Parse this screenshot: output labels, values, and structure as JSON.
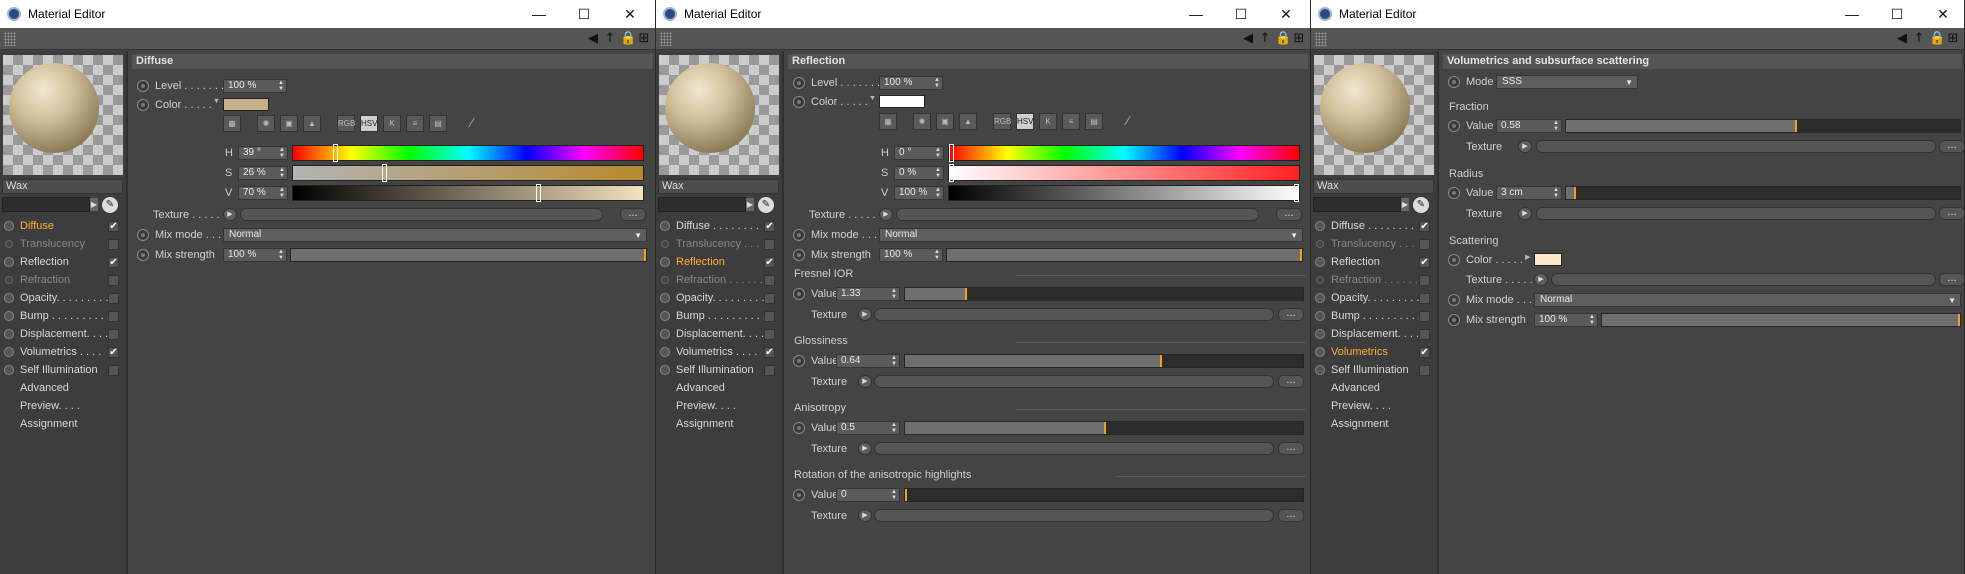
{
  "windows": [
    {
      "title": "Material Editor",
      "material_name": "Wax",
      "channels": [
        {
          "label": "Diffuse",
          "checked": true,
          "state": "selected"
        },
        {
          "label": "Translucency",
          "checked": false,
          "state": "disabled"
        },
        {
          "label": "Reflection",
          "checked": true,
          "state": "normal"
        },
        {
          "label": "Refraction",
          "checked": false,
          "state": "disabled"
        },
        {
          "label": "Opacity. . . . . . . . .",
          "checked": false,
          "state": "normal"
        },
        {
          "label": "Bump . . . . . . . . . .",
          "checked": false,
          "state": "normal"
        },
        {
          "label": "Displacement. . . .",
          "checked": false,
          "state": "normal"
        },
        {
          "label": "Volumetrics . . . .",
          "checked": true,
          "state": "normal"
        },
        {
          "label": "Self Illumination",
          "checked": false,
          "state": "normal"
        }
      ],
      "extra_items": [
        "Advanced",
        "Preview. . . .",
        "Assignment"
      ],
      "section": "Diffuse",
      "level_label": "Level . . . . . . .",
      "level_value": "100 %",
      "color_label": "Color . . . . .",
      "color_swatch": "#c4b18c",
      "h_label": "H",
      "h_value": "39 °",
      "h_pos": 0.12,
      "s_label": "S",
      "s_value": "26 %",
      "s_pos": 0.26,
      "v_label": "V",
      "v_value": "70 %",
      "v_pos": 0.7,
      "texture_label": "Texture . . . . . . .",
      "mixmode_label": "Mix mode . . .",
      "mixmode_value": "Normal",
      "mixstrength_label": "Mix strength",
      "mixstrength_value": "100 %",
      "dots": "..."
    },
    {
      "title": "Material Editor",
      "material_name": "Wax",
      "channels": [
        {
          "label": "Diffuse . . . . . . . .",
          "checked": true,
          "state": "normal"
        },
        {
          "label": "Translucency . . .",
          "checked": false,
          "state": "disabled"
        },
        {
          "label": "Reflection",
          "checked": true,
          "state": "selected"
        },
        {
          "label": "Refraction . . . . . .",
          "checked": false,
          "state": "disabled"
        },
        {
          "label": "Opacity. . . . . . . . .",
          "checked": false,
          "state": "normal"
        },
        {
          "label": "Bump . . . . . . . . . .",
          "checked": false,
          "state": "normal"
        },
        {
          "label": "Displacement. . . .",
          "checked": false,
          "state": "normal"
        },
        {
          "label": "Volumetrics . . . .",
          "checked": true,
          "state": "normal"
        },
        {
          "label": "Self Illumination",
          "checked": false,
          "state": "normal"
        }
      ],
      "extra_items": [
        "Advanced",
        "Preview. . . .",
        "Assignment"
      ],
      "section": "Reflection",
      "level_label": "Level . . . . . . .",
      "level_value": "100 %",
      "color_label": "Color . . . . .",
      "color_swatch": "#ffffff",
      "h_label": "H",
      "h_value": "0 °",
      "h_pos": 0.0,
      "s_label": "S",
      "s_value": "0 %",
      "s_pos": 0.0,
      "v_label": "V",
      "v_value": "100 %",
      "v_pos": 1.0,
      "texture_label": "Texture . . . . . . .",
      "mixmode_label": "Mix mode . . .",
      "mixmode_value": "Normal",
      "mixstrength_label": "Mix strength",
      "mixstrength_value": "100 %",
      "groups": [
        {
          "label": "Fresnel IOR",
          "value": "1.33",
          "fraction": 0.15
        },
        {
          "label": "Glossiness",
          "value": "0.64",
          "fraction": 0.64
        },
        {
          "label": "Anisotropy",
          "value": "0.5",
          "fraction": 0.5
        },
        {
          "label": "Rotation of the anisotropic highlights",
          "value": "0",
          "fraction": 0.0
        }
      ],
      "value_label": "Value",
      "group_texture_label": "Texture",
      "dots": "..."
    },
    {
      "title": "Material Editor",
      "material_name": "Wax",
      "channels": [
        {
          "label": "Diffuse . . . . . . . .",
          "checked": true,
          "state": "normal"
        },
        {
          "label": "Translucency . . .",
          "checked": false,
          "state": "disabled"
        },
        {
          "label": "Reflection",
          "checked": true,
          "state": "normal"
        },
        {
          "label": "Refraction . . . . . .",
          "checked": false,
          "state": "disabled"
        },
        {
          "label": "Opacity. . . . . . . . .",
          "checked": false,
          "state": "normal"
        },
        {
          "label": "Bump . . . . . . . . . .",
          "checked": false,
          "state": "normal"
        },
        {
          "label": "Displacement. . . .",
          "checked": false,
          "state": "normal"
        },
        {
          "label": "Volumetrics",
          "checked": true,
          "state": "selected"
        },
        {
          "label": "Self Illumination",
          "checked": false,
          "state": "normal"
        }
      ],
      "extra_items": [
        "Advanced",
        "Preview. . . .",
        "Assignment"
      ],
      "section": "Volumetrics and subsurface scattering",
      "mode_label": "Mode",
      "mode_value": "SSS",
      "fraction_group": "Fraction",
      "fraction_value": "0.58",
      "fraction_pos": 0.58,
      "radius_group": "Radius",
      "radius_value": "3 cm",
      "radius_pos": 0.02,
      "value_label": "Value",
      "texture_label": "Texture",
      "scattering_group": "Scattering",
      "scatter_color_label": "Color . . . . .",
      "scatter_color": "#fde8c8",
      "scatter_texture_label": "Texture . . . . . . .",
      "mixmode_label": "Mix mode . . .",
      "mixmode_value": "Normal",
      "mixstrength_label": "Mix strength",
      "mixstrength_value": "100 %",
      "dots": "..."
    }
  ]
}
